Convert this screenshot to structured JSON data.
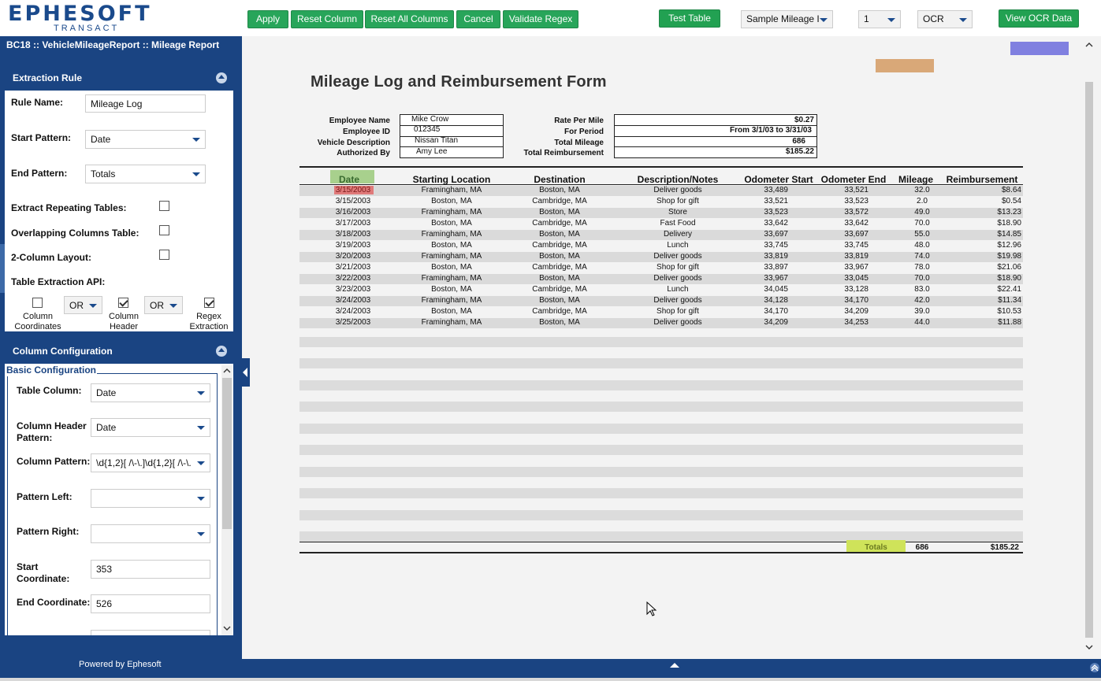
{
  "brand": {
    "name": "EPHESOFT",
    "sub": "TRANSACT"
  },
  "toolbar": {
    "apply": "Apply",
    "reset_column": "Reset Column",
    "reset_all": "Reset All Columns",
    "cancel": "Cancel",
    "validate": "Validate Regex",
    "test_table": "Test Table",
    "document_select": "Sample Mileage I",
    "page_select": "1",
    "mode_select": "OCR",
    "view_ocr": "View OCR Data"
  },
  "breadcrumb": "BC18 :: VehicleMileageReport :: Mileage Report",
  "extraction_rule": {
    "title": "Extraction Rule",
    "rule_name_label": "Rule Name:",
    "rule_name_value": "Mileage Log",
    "start_pattern_label": "Start Pattern:",
    "start_pattern_value": "Date",
    "end_pattern_label": "End Pattern:",
    "end_pattern_value": "Totals",
    "extract_repeating_label": "Extract Repeating Tables:",
    "overlapping_label": "Overlapping Columns Table:",
    "two_col_label": "2-Column Layout:",
    "api_label": "Table Extraction API:",
    "op1": "OR",
    "op2": "OR",
    "col_coord": [
      "Column",
      "Coordinates"
    ],
    "col_header": [
      "Column",
      "Header"
    ],
    "regex_ext": [
      "Regex",
      "Extraction"
    ]
  },
  "column_config": {
    "title": "Column Configuration",
    "basic_legend": "Basic Configuration",
    "table_column_label": "Table Column:",
    "table_column_value": "Date",
    "header_pattern_label": [
      "Column Header",
      "Pattern:"
    ],
    "header_pattern_value": "Date",
    "column_pattern_label": "Column Pattern:",
    "column_pattern_value": "\\d{1,2}[ /\\-\\.]\\d{1,2}[ /\\-\\.",
    "pattern_left_label": "Pattern Left:",
    "pattern_right_label": "Pattern Right:",
    "start_coord_label": [
      "Start",
      "Coordinate:"
    ],
    "start_coord_value": "353",
    "end_coord_label": "End Coordinate:",
    "end_coord_value": "526"
  },
  "footer": {
    "powered": "Powered by Ephesoft"
  },
  "document": {
    "title": "Mileage Log and Reimbursement Form",
    "info_left": [
      {
        "label": "Employee Name",
        "value": "Mike Crow"
      },
      {
        "label": "Employee ID",
        "value": "012345"
      },
      {
        "label": "Vehicle Description",
        "value": "Nissan Titan"
      },
      {
        "label": "Authorized By",
        "value": "Amy Lee"
      }
    ],
    "info_right": [
      {
        "label": "Rate Per Mile",
        "value": "$0.27"
      },
      {
        "label": "For Period",
        "value": "From 3/1/03 to 3/31/03"
      },
      {
        "label": "Total Mileage",
        "value": "686"
      },
      {
        "label": "Total Reimbursement",
        "value": "$185.22"
      }
    ],
    "headers": [
      "Date",
      "Starting Location",
      "Destination",
      "Description/Notes",
      "Odometer Start",
      "Odometer End",
      "Mileage",
      "Reimbursement"
    ],
    "rows": [
      [
        "3/15/2003",
        "Framingham, MA",
        "Boston, MA",
        "Deliver goods",
        "33,489",
        "33,521",
        "32.0",
        "$8.64"
      ],
      [
        "3/15/2003",
        "Boston, MA",
        "Cambridge, MA",
        "Shop for gift",
        "33,521",
        "33,523",
        "2.0",
        "$0.54"
      ],
      [
        "3/16/2003",
        "Framingham, MA",
        "Boston, MA",
        "Store",
        "33,523",
        "33,572",
        "49.0",
        "$13.23"
      ],
      [
        "3/17/2003",
        "Boston, MA",
        "Cambridge, MA",
        "Fast Food",
        "33,642",
        "33,642",
        "70.0",
        "$18.90"
      ],
      [
        "3/18/2003",
        "Framingham, MA",
        "Boston, MA",
        "Delivery",
        "33,697",
        "33,697",
        "55.0",
        "$14.85"
      ],
      [
        "3/19/2003",
        "Boston, MA",
        "Cambridge, MA",
        "Lunch",
        "33,745",
        "33,745",
        "48.0",
        "$12.96"
      ],
      [
        "3/20/2003",
        "Framingham, MA",
        "Boston, MA",
        "Deliver goods",
        "33,819",
        "33,819",
        "74.0",
        "$19.98"
      ],
      [
        "3/21/2003",
        "Boston, MA",
        "Cambridge, MA",
        "Shop for gift",
        "33,897",
        "33,967",
        "78.0",
        "$21.06"
      ],
      [
        "3/22/2003",
        "Framingham, MA",
        "Boston, MA",
        "Deliver goods",
        "33,967",
        "33,045",
        "70.0",
        "$18.90"
      ],
      [
        "3/23/2003",
        "Boston, MA",
        "Cambridge, MA",
        "Lunch",
        "34,045",
        "33,128",
        "83.0",
        "$22.41"
      ],
      [
        "3/24/2003",
        "Framingham, MA",
        "Boston, MA",
        "Deliver goods",
        "34,128",
        "34,170",
        "42.0",
        "$11.34"
      ],
      [
        "3/24/2003",
        "Boston, MA",
        "Cambridge, MA",
        "Shop for gift",
        "34,170",
        "34,209",
        "39.0",
        "$10.53"
      ],
      [
        "3/25/2003",
        "Framingham, MA",
        "Boston, MA",
        "Deliver goods",
        "34,209",
        "34,253",
        "44.0",
        "$11.88"
      ]
    ],
    "totals_label": "Totals",
    "totals_mileage": "686",
    "totals_amount": "$185.22"
  },
  "colors": {
    "accent": "#1a4482",
    "button": "#28a55a",
    "date_highlight": "#a8d08d",
    "totals_highlight": "#cfe35a",
    "selected_cell": "#e07a7a",
    "marker_orange": "#d9a878",
    "marker_purple": "#8080e0"
  }
}
